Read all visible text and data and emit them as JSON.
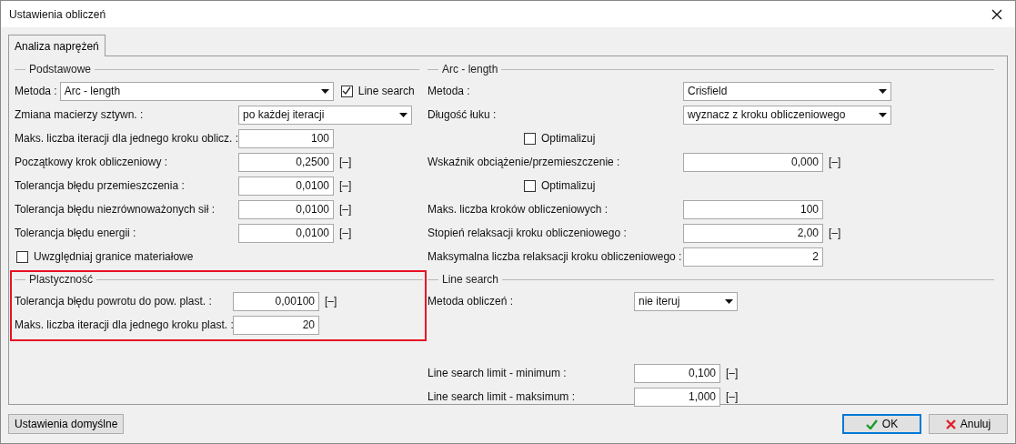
{
  "window": {
    "title": "Ustawienia obliczeń"
  },
  "tabs": [
    {
      "label": "Analiza naprężeń",
      "selected": true
    }
  ],
  "columns": [
    {
      "sections": [
        {
          "title": "Podstawowe",
          "highlighted": false,
          "rows": [
            {
              "kind": "select",
              "label": "Metoda :",
              "value": "Arc - length",
              "checkbox": {
                "label": "Line search",
                "checked": true
              }
            },
            {
              "kind": "select",
              "label": "Zmiana macierzy sztywn. :",
              "value": "po każdej iteracji"
            },
            {
              "kind": "number",
              "label": "Maks. liczba iteracji dla jednego kroku oblicz. :",
              "value": "100"
            },
            {
              "kind": "number",
              "label": "Początkowy krok obliczeniowy :",
              "value": "0,2500",
              "unit": "[–]"
            },
            {
              "kind": "number",
              "label": "Tolerancja błędu przemieszczenia :",
              "value": "0,0100",
              "unit": "[–]"
            },
            {
              "kind": "number",
              "label": "Tolerancja błędu niezrównoważonych sił :",
              "value": "0,0100",
              "unit": "[–]"
            },
            {
              "kind": "number",
              "label": "Tolerancja błędu energii :",
              "value": "0,0100",
              "unit": "[–]"
            },
            {
              "kind": "checkbox",
              "label": "Uwzględniaj granice materiałowe",
              "checked": false
            }
          ]
        },
        {
          "title": "Plastyczność",
          "highlighted": true,
          "rows": [
            {
              "kind": "number",
              "label": "Tolerancja błędu powrotu do pow. plast. :",
              "value": "0,00100",
              "unit": "[–]"
            },
            {
              "kind": "number",
              "label": "Maks. liczba iteracji dla jednego kroku plast. :",
              "value": "20"
            }
          ]
        }
      ]
    },
    {
      "sections": [
        {
          "title": "Arc - length",
          "highlighted": false,
          "rows": [
            {
              "kind": "select",
              "label": "Metoda :",
              "value": "Crisfield"
            },
            {
              "kind": "select",
              "label": "Długość łuku :",
              "value": "wyznacz z kroku obliczeniowego"
            },
            {
              "kind": "checkbox",
              "label": "Optimalizuj",
              "checked": false
            },
            {
              "kind": "number",
              "label": "Wskaźnik obciążenie/przemieszczenie :",
              "value": "0,000",
              "unit": "[–]"
            },
            {
              "kind": "checkbox",
              "label": "Optimalizuj",
              "checked": false
            },
            {
              "kind": "number",
              "label": "Maks. liczba kroków obliczeniowych :",
              "value": "100"
            },
            {
              "kind": "number",
              "label": "Stopień relaksacji kroku obliczeniowego :",
              "value": "2,00",
              "unit": "[–]"
            },
            {
              "kind": "number",
              "label": "Maksymalna liczba relaksacji kroku obliczeniowego :",
              "value": "2"
            }
          ]
        },
        {
          "title": "Line search",
          "highlighted": false,
          "rows": [
            {
              "kind": "select",
              "label": "Metoda obliczeń :",
              "value": "nie iteruj"
            },
            {
              "kind": "number",
              "label": "Line search limit - minimum :",
              "value": "0,100",
              "unit": "[–]"
            },
            {
              "kind": "number",
              "label": "Line search limit - maksimum :",
              "value": "1,000",
              "unit": "[–]"
            }
          ]
        }
      ]
    }
  ],
  "buttons": [
    {
      "kind": "plain",
      "label": "Ustawienia domyślne",
      "default": false
    },
    {
      "kind": "ok",
      "label": "OK",
      "default": true
    },
    {
      "kind": "cancel",
      "label": "Anuluj",
      "default": false
    }
  ]
}
